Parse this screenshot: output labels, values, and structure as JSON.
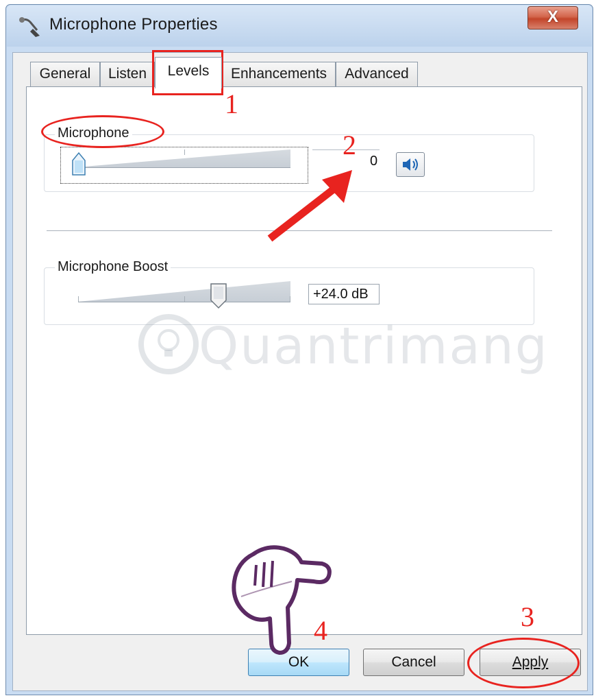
{
  "window": {
    "title": "Microphone Properties",
    "close_label": "X"
  },
  "tabs": [
    {
      "label": "General",
      "active": false
    },
    {
      "label": "Listen",
      "active": false
    },
    {
      "label": "Levels",
      "active": true
    },
    {
      "label": "Enhancements",
      "active": false
    },
    {
      "label": "Advanced",
      "active": false
    }
  ],
  "microphone": {
    "group_label": "Microphone",
    "level": 0,
    "value_text": "0",
    "muted": false
  },
  "boost": {
    "group_label": "Microphone Boost",
    "value_text": "+24.0 dB",
    "level_fraction": 0.67
  },
  "buttons": {
    "ok": "OK",
    "cancel": "Cancel",
    "apply": "Apply"
  },
  "annotations": {
    "step1": "1",
    "step2": "2",
    "step3": "3",
    "step4": "4"
  },
  "watermark": "Quantrimang",
  "colors": {
    "annotation": "#e8231f",
    "hand": "#5b2a63"
  },
  "icons": {
    "title": "microphone-icon",
    "speaker": "speaker-icon",
    "pointer": "pointing-hand-icon"
  }
}
